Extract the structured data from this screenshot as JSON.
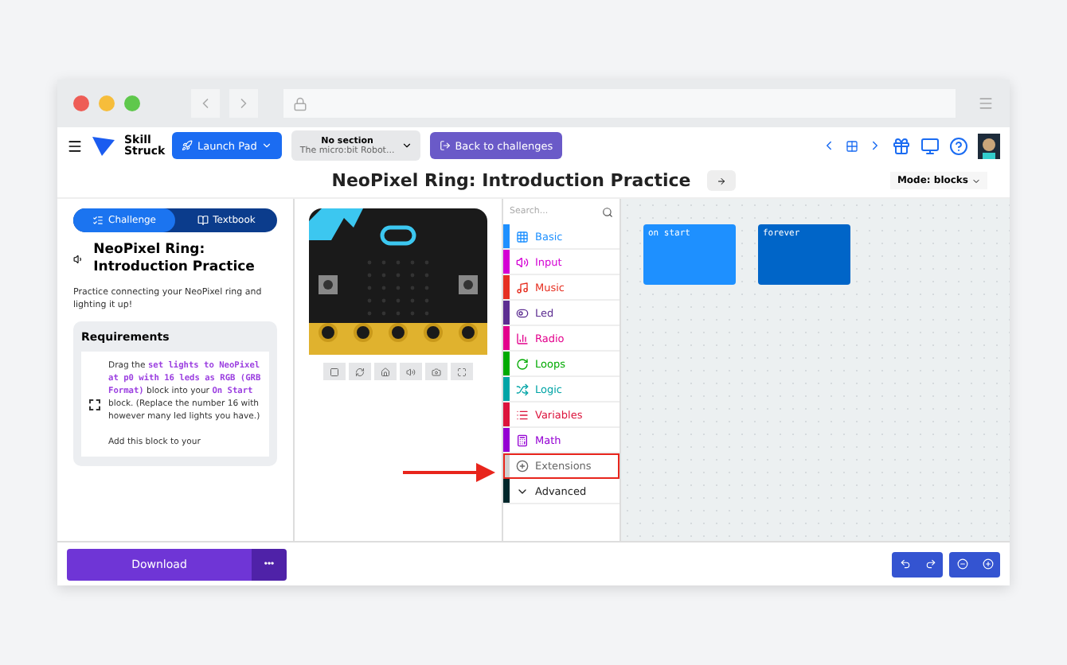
{
  "header": {
    "logo": "Skill Struck",
    "launch_pad": "Launch Pad",
    "section": {
      "title": "No section",
      "subtitle": "The micro:bit Robot..."
    },
    "back": "Back to challenges"
  },
  "title": "NeoPixel Ring: Introduction Practice",
  "mode": "Mode: blocks",
  "tabs": [
    {
      "label": "Challenge",
      "selected": true
    },
    {
      "label": "Textbook",
      "selected": false
    }
  ],
  "challenge": {
    "title": "NeoPixel Ring: Introduction Practice",
    "description": "Practice connecting your NeoPixel ring and lighting it up!",
    "requirements_title": "Requirements",
    "requirements": [
      {
        "text": "Drag the **set lights to NeoPixel at p0 with 16 leds as RGB (GRB Format)** block into your **On Start** block. (Replace the number 16 with however many led lights you have.)",
        "checked": false,
        "extra": "Add this block to your"
      }
    ]
  },
  "search": {
    "placeholder": "Search..."
  },
  "categories": [
    {
      "label": "Basic",
      "color": "#1e90ff",
      "highlighted": false
    },
    {
      "label": "Input",
      "color": "#d400d4",
      "highlighted": false
    },
    {
      "label": "Music",
      "color": "#e63022",
      "highlighted": false
    },
    {
      "label": "Led",
      "color": "#5c2d91",
      "highlighted": false
    },
    {
      "label": "Radio",
      "color": "#e3008c",
      "highlighted": false
    },
    {
      "label": "Loops",
      "color": "#00aa00",
      "highlighted": false
    },
    {
      "label": "Logic",
      "color": "#00a4a6",
      "highlighted": false
    },
    {
      "label": "Variables",
      "color": "#dc143c",
      "highlighted": false
    },
    {
      "label": "Math",
      "color": "#9400d3",
      "highlighted": false
    },
    {
      "label": "Extensions",
      "color": "#d0d0d0",
      "highlighted": true
    },
    {
      "label": "Advanced",
      "color": "#00272b",
      "highlighted": false
    }
  ],
  "blocks": [
    {
      "label": "on start",
      "color": "#1e90ff"
    },
    {
      "label": "forever",
      "color": "#0065c8"
    }
  ],
  "download": "Download",
  "more": "•••"
}
